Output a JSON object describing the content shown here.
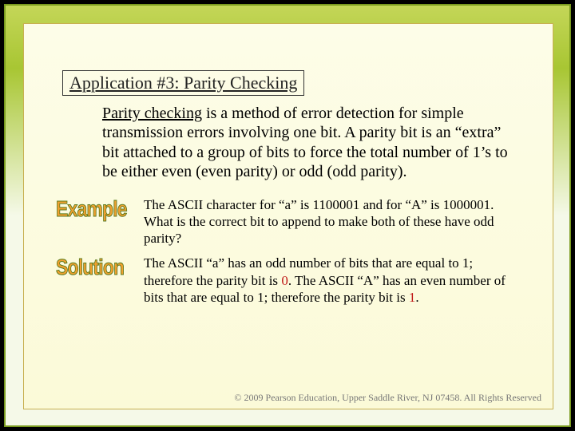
{
  "title": "Application #3: Parity Checking",
  "intro_lead": "Parity checking",
  "intro_rest": " is a method of error detection for simple transmission errors involving one bit. A parity bit is an “extra” bit attached to a group of bits to force the total number of 1’s to be either even (even parity) or odd (odd parity).",
  "example_label": "Example",
  "example_text": "The ASCII character for “a” is 1100001 and for “A” is 1000001. What is the correct bit to append to make both of these have odd parity?",
  "solution_label": "Solution",
  "solution_pre": "The ASCII “a” has an odd number of bits that are equal to 1; therefore the parity bit is ",
  "solution_zero": "0",
  "solution_mid": ". The ASCII “A” has an even number of bits that are equal to 1; therefore the parity bit is ",
  "solution_one": "1",
  "solution_end": ".",
  "footer": "© 2009 Pearson Education, Upper Saddle River, NJ 07458. All Rights Reserved"
}
